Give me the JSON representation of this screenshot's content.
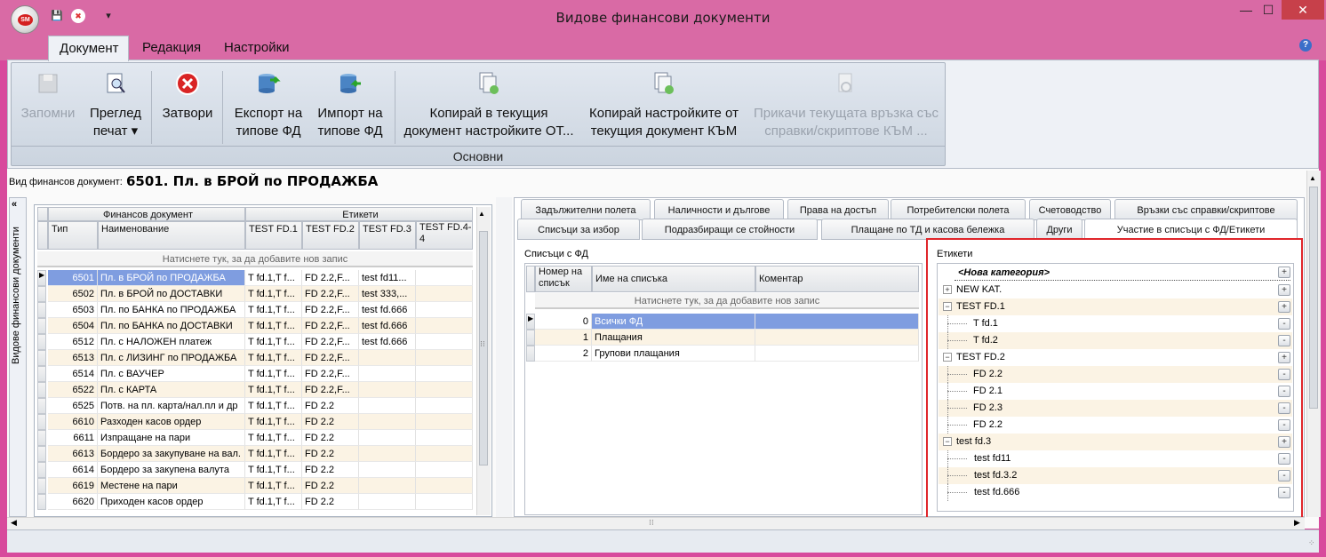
{
  "window": {
    "title": "Видове финансови документи",
    "min": "—",
    "max": "☐",
    "close": "✕"
  },
  "app_orb": {
    "label": "SM"
  },
  "qat": {
    "save_icon": "💾",
    "close_icon": "✖",
    "dropdown": "▾"
  },
  "menu": {
    "tabs": [
      "Документ",
      "Редакция",
      "Настройки"
    ],
    "help": "?"
  },
  "ribbon": {
    "group_caption": "Основни",
    "buttons": [
      {
        "line1": "Запомни",
        "line2": ""
      },
      {
        "line1": "Преглед",
        "line2": "печат ▾"
      },
      {
        "line1": "Затвори",
        "line2": ""
      },
      {
        "line1": "Експорт на",
        "line2": "типове ФД"
      },
      {
        "line1": "Импорт на",
        "line2": "типове ФД"
      },
      {
        "line1": "Копирай в текущия",
        "line2": "документ настройките ОТ..."
      },
      {
        "line1": "Копирай настройките от",
        "line2": "текущия документ КЪМ"
      },
      {
        "line1": "Прикачи текущата връзка със",
        "line2": "справки/скриптове КЪМ ..."
      }
    ]
  },
  "doc": {
    "label": "Вид финансов документ:",
    "value": "6501. Пл. в БРОЙ по ПРОДАЖБА"
  },
  "left": {
    "side_label": "Видове финансови документи",
    "band1": "Финансов документ",
    "band2": "Етикети",
    "cols": [
      "Тип",
      "Наименование",
      "TEST FD.1",
      "TEST FD.2",
      "TEST FD.3",
      "TEST FD.4-4"
    ],
    "new_row": "Натиснете тук, за да добавите нов запис",
    "rows": [
      [
        "6501",
        "Пл. в БРОЙ по ПРОДАЖБА",
        "T fd.1,T f...",
        "FD 2.2,F...",
        "test fd11...",
        ""
      ],
      [
        "6502",
        "Пл. в БРОЙ по ДОСТАВКИ",
        "T fd.1,T f...",
        "FD 2.2,F...",
        "test 333,...",
        ""
      ],
      [
        "6503",
        "Пл. по БАНКА по ПРОДАЖБА",
        "T fd.1,T f...",
        "FD 2.2,F...",
        "test fd.666",
        ""
      ],
      [
        "6504",
        "Пл. по БАНКА по ДОСТАВКИ",
        "T fd.1,T f...",
        "FD 2.2,F...",
        "test fd.666",
        ""
      ],
      [
        "6512",
        "Пл. с НАЛОЖЕН платеж",
        "T fd.1,T f...",
        "FD 2.2,F...",
        "test fd.666",
        ""
      ],
      [
        "6513",
        "Пл. с ЛИЗИНГ по ПРОДАЖБА",
        "T fd.1,T f...",
        "FD 2.2,F...",
        "",
        ""
      ],
      [
        "6514",
        "Пл. с ВАУЧЕР",
        "T fd.1,T f...",
        "FD 2.2,F...",
        "",
        ""
      ],
      [
        "6522",
        "Пл. с КАРТА",
        "T fd.1,T f...",
        "FD 2.2,F...",
        "",
        ""
      ],
      [
        "6525",
        "Потв. на пл. карта/нал.пл и др",
        "T fd.1,T f...",
        "FD 2.2",
        "",
        ""
      ],
      [
        "6610",
        "Разходен касов ордер",
        "T fd.1,T f...",
        "FD 2.2",
        "",
        ""
      ],
      [
        "6611",
        "Изпращане на пари",
        "T fd.1,T f...",
        "FD 2.2",
        "",
        ""
      ],
      [
        "6613",
        "Бордеро за закупуване на вал.",
        "T fd.1,T f...",
        "FD 2.2",
        "",
        ""
      ],
      [
        "6614",
        "Бордеро за закупена валута",
        "T fd.1,T f...",
        "FD 2.2",
        "",
        ""
      ],
      [
        "6619",
        "Местене на пари",
        "T fd.1,T f...",
        "FD 2.2",
        "",
        ""
      ],
      [
        "6620",
        "Приходен касов ордер",
        "T fd.1,T f...",
        "FD 2.2",
        "",
        ""
      ]
    ]
  },
  "tabs_row1": [
    "Задължителни полета",
    "Наличности и дългове",
    "Права на достъп",
    "Потребителски полета",
    "Счетоводство",
    "Връзки със справки/скриптове"
  ],
  "tabs_row2": [
    "Списъци за избор",
    "Подразбиращи се стойности",
    "Плащане по ТД и касова бележка",
    "Други",
    "Участие в списъци с ФД/Етикети"
  ],
  "lists": {
    "caption": "Списъци с ФД",
    "cols": [
      "Номер на списък",
      "Име на списъка",
      "Коментар"
    ],
    "new_row": "Натиснете тук, за да добавите нов запис",
    "rows": [
      [
        "0",
        "Всички ФД",
        ""
      ],
      [
        "1",
        "Плащания",
        ""
      ],
      [
        "2",
        "Групови плащания",
        ""
      ]
    ]
  },
  "labels": {
    "caption": "Етикети",
    "new_category": "<Нова категория>",
    "tree": [
      {
        "level": 0,
        "expander": "+",
        "text": "NEW KAT.",
        "btn": "+"
      },
      {
        "level": 0,
        "expander": "−",
        "text": "TEST FD.1",
        "btn": "+"
      },
      {
        "level": 1,
        "expander": "",
        "text": "T fd.1",
        "btn": "-"
      },
      {
        "level": 1,
        "expander": "",
        "text": "T fd.2",
        "btn": "-"
      },
      {
        "level": 0,
        "expander": "−",
        "text": "TEST FD.2",
        "btn": "+"
      },
      {
        "level": 1,
        "expander": "",
        "text": "FD 2.2",
        "btn": "-"
      },
      {
        "level": 1,
        "expander": "",
        "text": "FD 2.1",
        "btn": "-"
      },
      {
        "level": 1,
        "expander": "",
        "text": "FD 2.3",
        "btn": "-"
      },
      {
        "level": 1,
        "expander": "",
        "text": "FD 2.2",
        "btn": "-"
      },
      {
        "level": 0,
        "expander": "−",
        "text": "test fd.3",
        "btn": "+"
      },
      {
        "level": 1,
        "expander": "",
        "text": "test fd11",
        "btn": "-"
      },
      {
        "level": 1,
        "expander": "",
        "text": "test fd.3.2",
        "btn": "-"
      },
      {
        "level": 1,
        "expander": "",
        "text": "test fd.666",
        "btn": "-"
      }
    ]
  },
  "colors": {
    "highlight_border": "#e0262b",
    "selection": "#7f9de0",
    "titlebar": "#d96aa5"
  }
}
